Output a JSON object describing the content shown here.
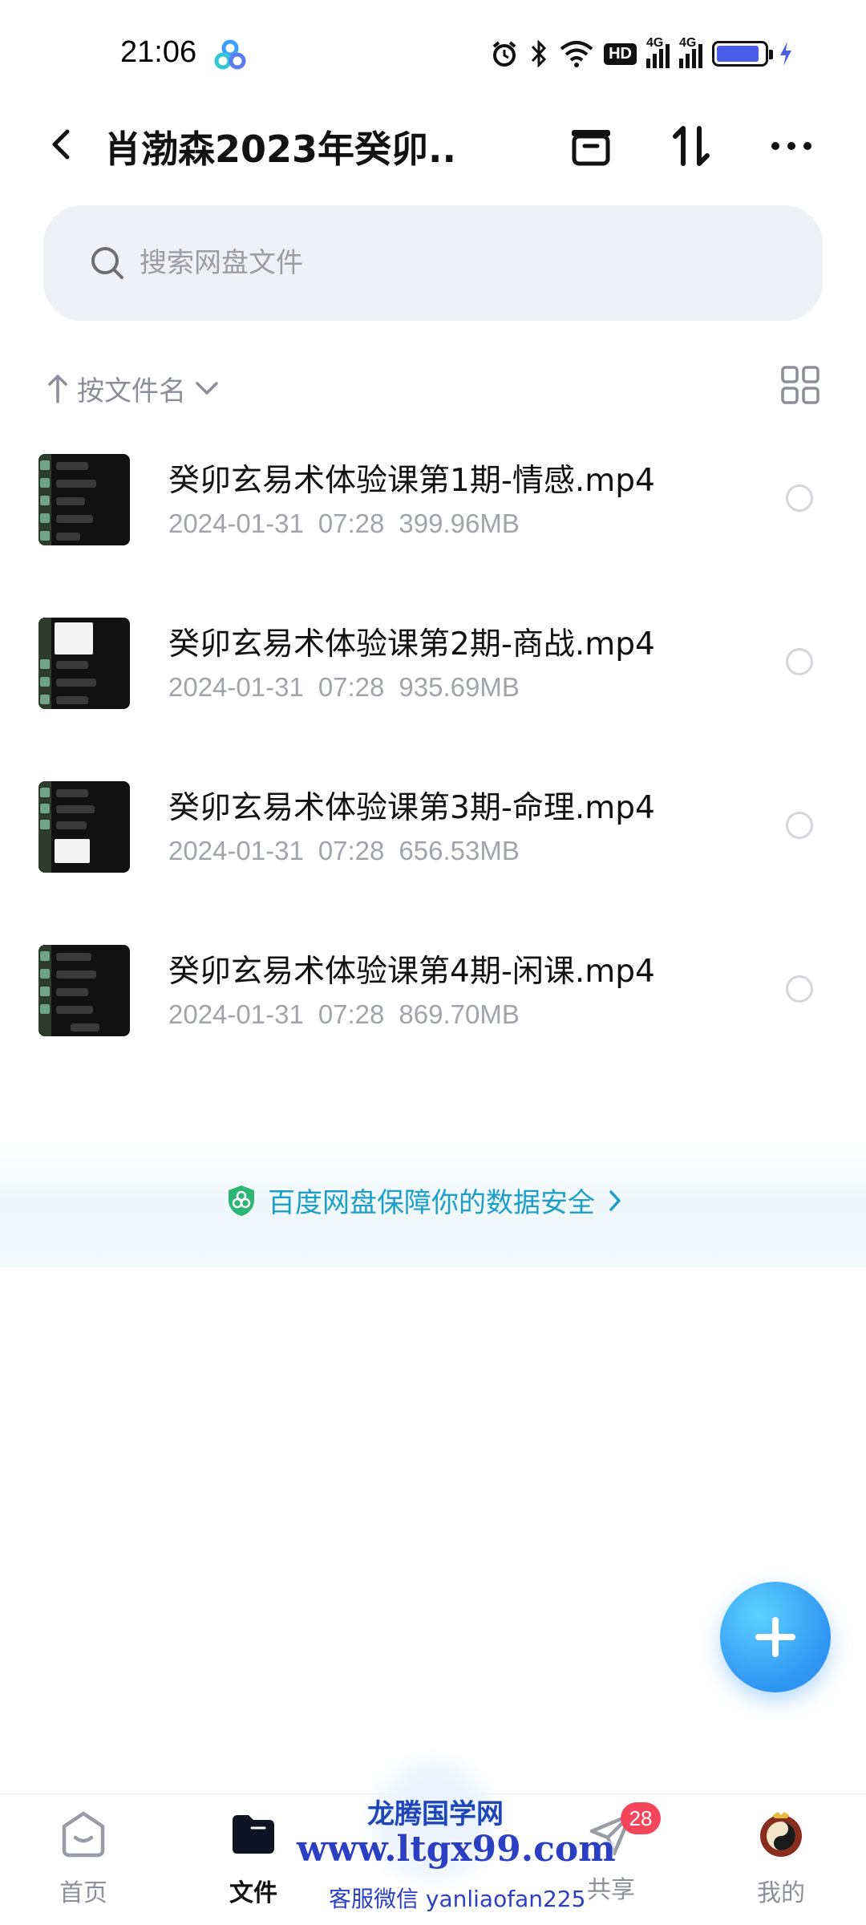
{
  "status_bar": {
    "time": "21:06",
    "network_1": "4G",
    "network_2": "4G",
    "hd_label": "HD",
    "battery_level": 0.9
  },
  "header": {
    "title": "肖渤森2023年癸卯...",
    "icons": [
      "back-icon",
      "collect-icon",
      "sort-icon",
      "more-icon"
    ]
  },
  "search": {
    "placeholder": "搜索网盘文件"
  },
  "sort_bar": {
    "label": "按文件名"
  },
  "files": [
    {
      "name": "癸卯玄易术体验课第1期-情感.mp4",
      "date": "2024-01-31",
      "time": "07:28",
      "size": "399.96MB"
    },
    {
      "name": "癸卯玄易术体验课第2期-商战.mp4",
      "date": "2024-01-31",
      "time": "07:28",
      "size": "935.69MB"
    },
    {
      "name": "癸卯玄易术体验课第3期-命理.mp4",
      "date": "2024-01-31",
      "time": "07:28",
      "size": "656.53MB"
    },
    {
      "name": "癸卯玄易术体验课第4期-闲课.mp4",
      "date": "2024-01-31",
      "time": "07:28",
      "size": "869.70MB"
    }
  ],
  "security_banner": {
    "text": "百度网盘保障你的数据安全"
  },
  "bottom_nav": {
    "items": [
      {
        "label": "首页"
      },
      {
        "label": "文件"
      },
      {
        "label": "共享",
        "badge": "28"
      },
      {
        "label": "我的"
      }
    ]
  },
  "watermark": {
    "title": "龙腾国学网",
    "url": "www.ltgx99.com",
    "contact": "客服微信 yanliaofan225"
  },
  "colors": {
    "accent": "#2e95f3",
    "security_text": "#1b9fc9",
    "badge": "#f4455b",
    "search_bg": "#f0f1f6"
  }
}
